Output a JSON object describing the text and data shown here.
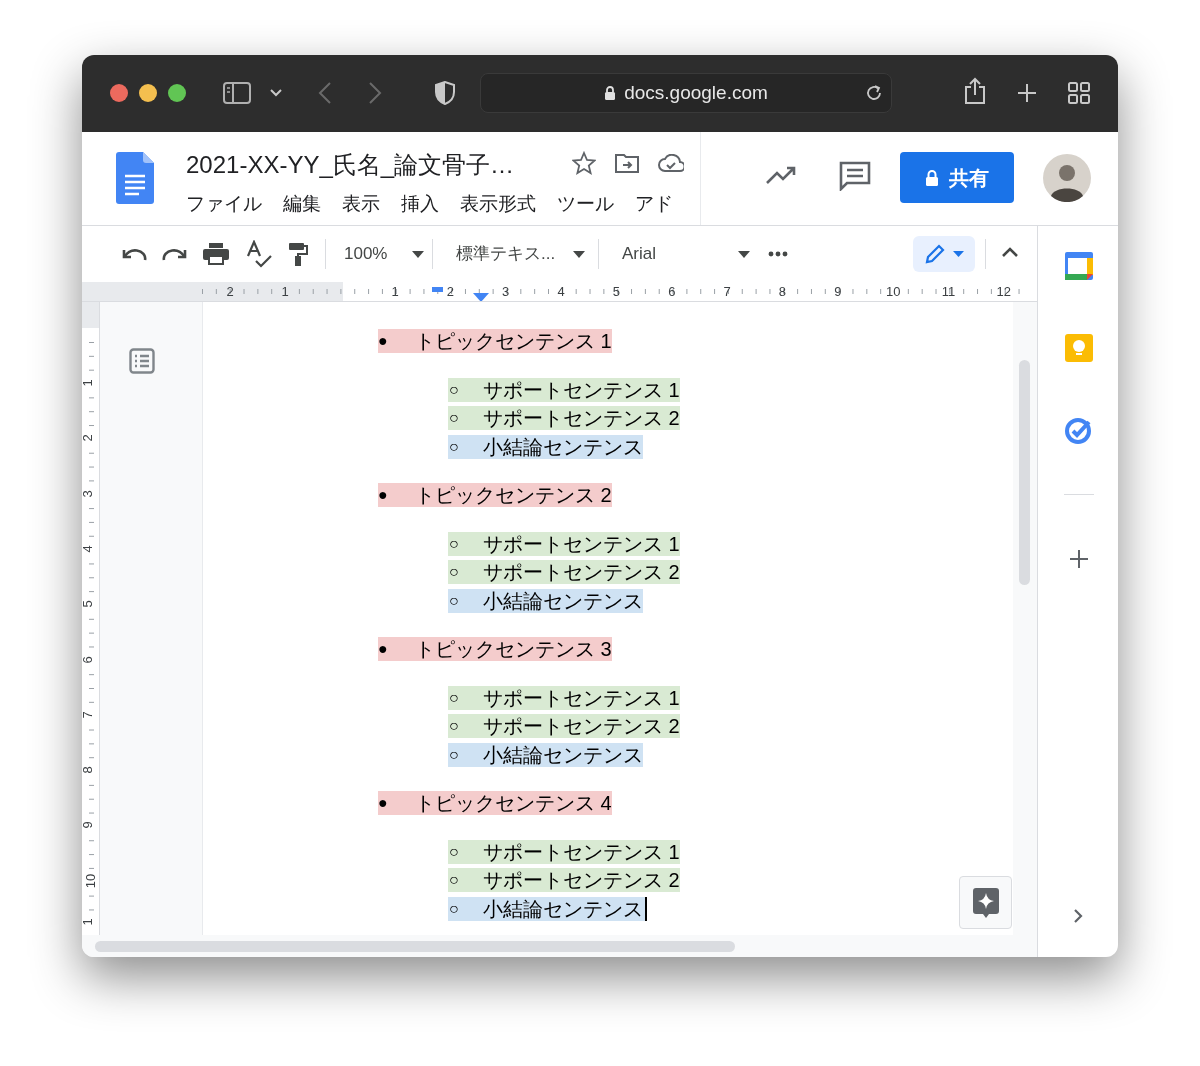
{
  "browser": {
    "url": "docs.google.com"
  },
  "document": {
    "title": "2021-XX-YY_氏名_論文骨子…",
    "menu": [
      "ファイル",
      "編集",
      "表示",
      "挿入",
      "表示形式",
      "ツール",
      "アド"
    ],
    "share_button": "共有"
  },
  "toolbar": {
    "zoom": "100%",
    "style": "標準テキス...",
    "font": "Arial"
  },
  "ruler": {
    "horizontal": [
      "2",
      "1",
      "1",
      "2",
      "3",
      "4",
      "5",
      "6",
      "7",
      "8",
      "9",
      "10",
      "11",
      "12"
    ],
    "vertical": [
      "1",
      "2",
      "3",
      "4",
      "5",
      "6",
      "7",
      "8",
      "9",
      "10",
      "1"
    ]
  },
  "outline": [
    {
      "kind": "topic",
      "bullet": "●",
      "text": "トピックセンテンス 1",
      "color": "#f4cccc",
      "cursor": false
    },
    {
      "kind": "sub",
      "bullet": "○",
      "text": "サポートセンテンス 1",
      "color": "#d9ead3",
      "cursor": false
    },
    {
      "kind": "sub",
      "bullet": "○",
      "text": "サポートセンテンス 2",
      "color": "#d9ead3",
      "cursor": false
    },
    {
      "kind": "sub",
      "bullet": "○",
      "text": "小結論センテンス",
      "color": "#cfe2f3",
      "cursor": false
    },
    {
      "kind": "topic",
      "bullet": "●",
      "text": "トピックセンテンス 2",
      "color": "#f4cccc",
      "cursor": false
    },
    {
      "kind": "sub",
      "bullet": "○",
      "text": "サポートセンテンス 1",
      "color": "#d9ead3",
      "cursor": false
    },
    {
      "kind": "sub",
      "bullet": "○",
      "text": "サポートセンテンス 2",
      "color": "#d9ead3",
      "cursor": false
    },
    {
      "kind": "sub",
      "bullet": "○",
      "text": "小結論センテンス",
      "color": "#cfe2f3",
      "cursor": false
    },
    {
      "kind": "topic",
      "bullet": "●",
      "text": "トピックセンテンス 3",
      "color": "#f4cccc",
      "cursor": false
    },
    {
      "kind": "sub",
      "bullet": "○",
      "text": "サポートセンテンス 1",
      "color": "#d9ead3",
      "cursor": false
    },
    {
      "kind": "sub",
      "bullet": "○",
      "text": "サポートセンテンス 2",
      "color": "#d9ead3",
      "cursor": false
    },
    {
      "kind": "sub",
      "bullet": "○",
      "text": "小結論センテンス",
      "color": "#cfe2f3",
      "cursor": false
    },
    {
      "kind": "topic",
      "bullet": "●",
      "text": "トピックセンテンス 4",
      "color": "#f4cccc",
      "cursor": false
    },
    {
      "kind": "sub",
      "bullet": "○",
      "text": "サポートセンテンス 1",
      "color": "#d9ead3",
      "cursor": false
    },
    {
      "kind": "sub",
      "bullet": "○",
      "text": "サポートセンテンス 2",
      "color": "#d9ead3",
      "cursor": false
    },
    {
      "kind": "sub",
      "bullet": "○",
      "text": "小結論センテンス",
      "color": "#cfe2f3",
      "cursor": true
    }
  ]
}
